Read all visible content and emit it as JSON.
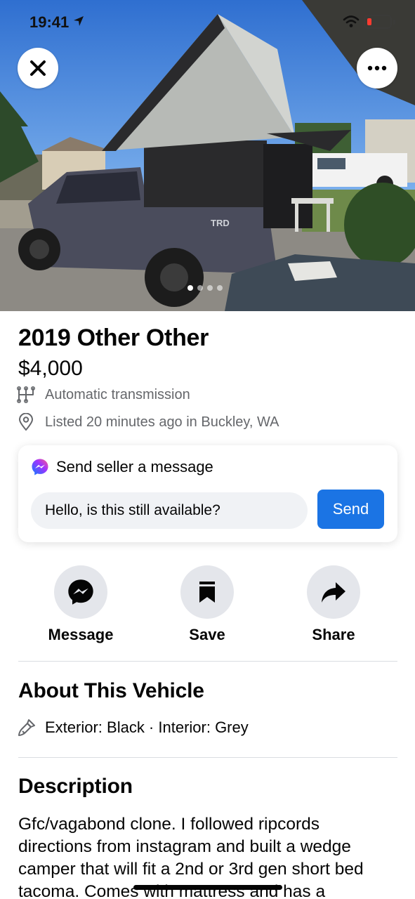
{
  "status_bar": {
    "time": "19:41"
  },
  "photo": {
    "current_index": 1,
    "total": 4
  },
  "listing": {
    "title": "2019 Other Other",
    "price": "$4,000",
    "transmission": "Automatic transmission",
    "listed": "Listed 20 minutes ago in Buckley, WA"
  },
  "message_card": {
    "heading": "Send seller a message",
    "input_value": "Hello, is this still available?",
    "send_label": "Send"
  },
  "actions": {
    "message_label": "Message",
    "save_label": "Save",
    "share_label": "Share"
  },
  "about": {
    "title": "About This Vehicle",
    "colors": "Exterior: Black · Interior: Grey"
  },
  "description": {
    "title": "Description",
    "text": "Gfc/vagabond clone. I followed ripcords directions from instagram and built a wedge camper that will fit a 2nd or 3rd gen short bed tacoma. Comes with mattress and has a"
  },
  "colors": {
    "accent": "#1b74e4",
    "secondary_text": "#65676b",
    "button_bg": "#e4e6eb",
    "input_bg": "#f0f2f5"
  },
  "icons": [
    "location-arrow-icon",
    "wifi-icon",
    "battery-icon",
    "close-icon",
    "more-icon",
    "transmission-icon",
    "location-pin-icon",
    "messenger-icon",
    "bookmark-icon",
    "share-arrow-icon",
    "paint-brush-icon"
  ]
}
